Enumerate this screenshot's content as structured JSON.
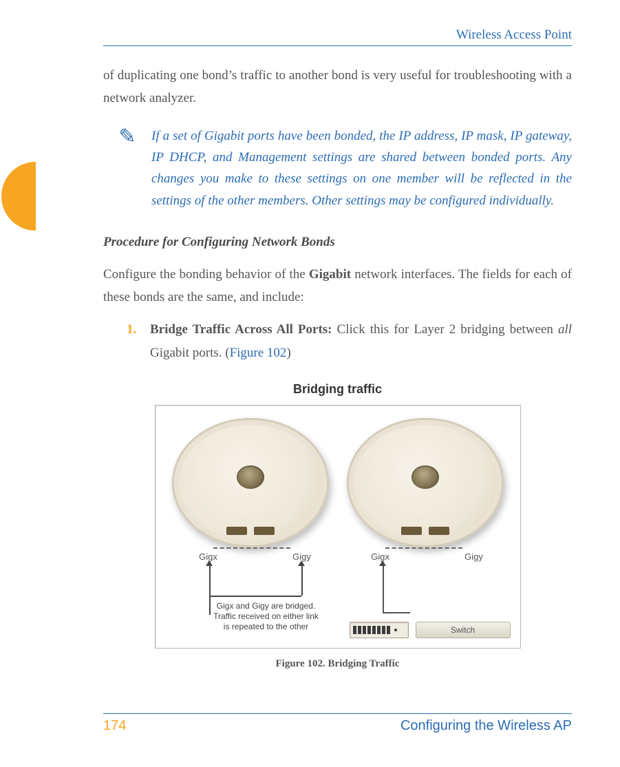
{
  "header": {
    "title": "Wireless Access Point"
  },
  "intro_paragraph": "of duplicating one bond’s traffic to another bond is very useful for troubleshooting with a network analyzer.",
  "note": {
    "icon_glyph": "✎",
    "text": "If a set of Gigabit ports have been bonded, the IP address, IP mask, IP gateway, IP DHCP, and Management settings are shared between bonded ports. Any changes you make to these settings on one member will be reflected in the settings of the other members. Other settings may be configured individually."
  },
  "section_heading": "Procedure for Configuring Network Bonds",
  "procedure_intro": {
    "pre": "Configure the bonding behavior of the ",
    "bold": "Gigabit",
    "post": " network interfaces. The fields for each of these bonds are the same, and include:"
  },
  "steps": [
    {
      "number": "1.",
      "bold": "Bridge Traffic Across All Ports: ",
      "text_before_italic": "Click this for Layer 2 bridging between ",
      "italic": "all",
      "text_after_italic": " Gigabit ports. (",
      "link": "Figure 102",
      "text_close": ")"
    }
  ],
  "figure": {
    "title": "Bridging traffic",
    "port_labels": [
      "Gigx",
      "Gigy",
      "Gigx",
      "Gigy"
    ],
    "callout_line1": "Gigx and Gigy are bridged.",
    "callout_line2": "Traffic received on either link",
    "callout_line3": "is repeated to the other",
    "switch_label": "Switch",
    "caption": "Figure 102. Bridging Traffic"
  },
  "footer": {
    "page_number": "174",
    "section": "Configuring the Wireless AP"
  }
}
